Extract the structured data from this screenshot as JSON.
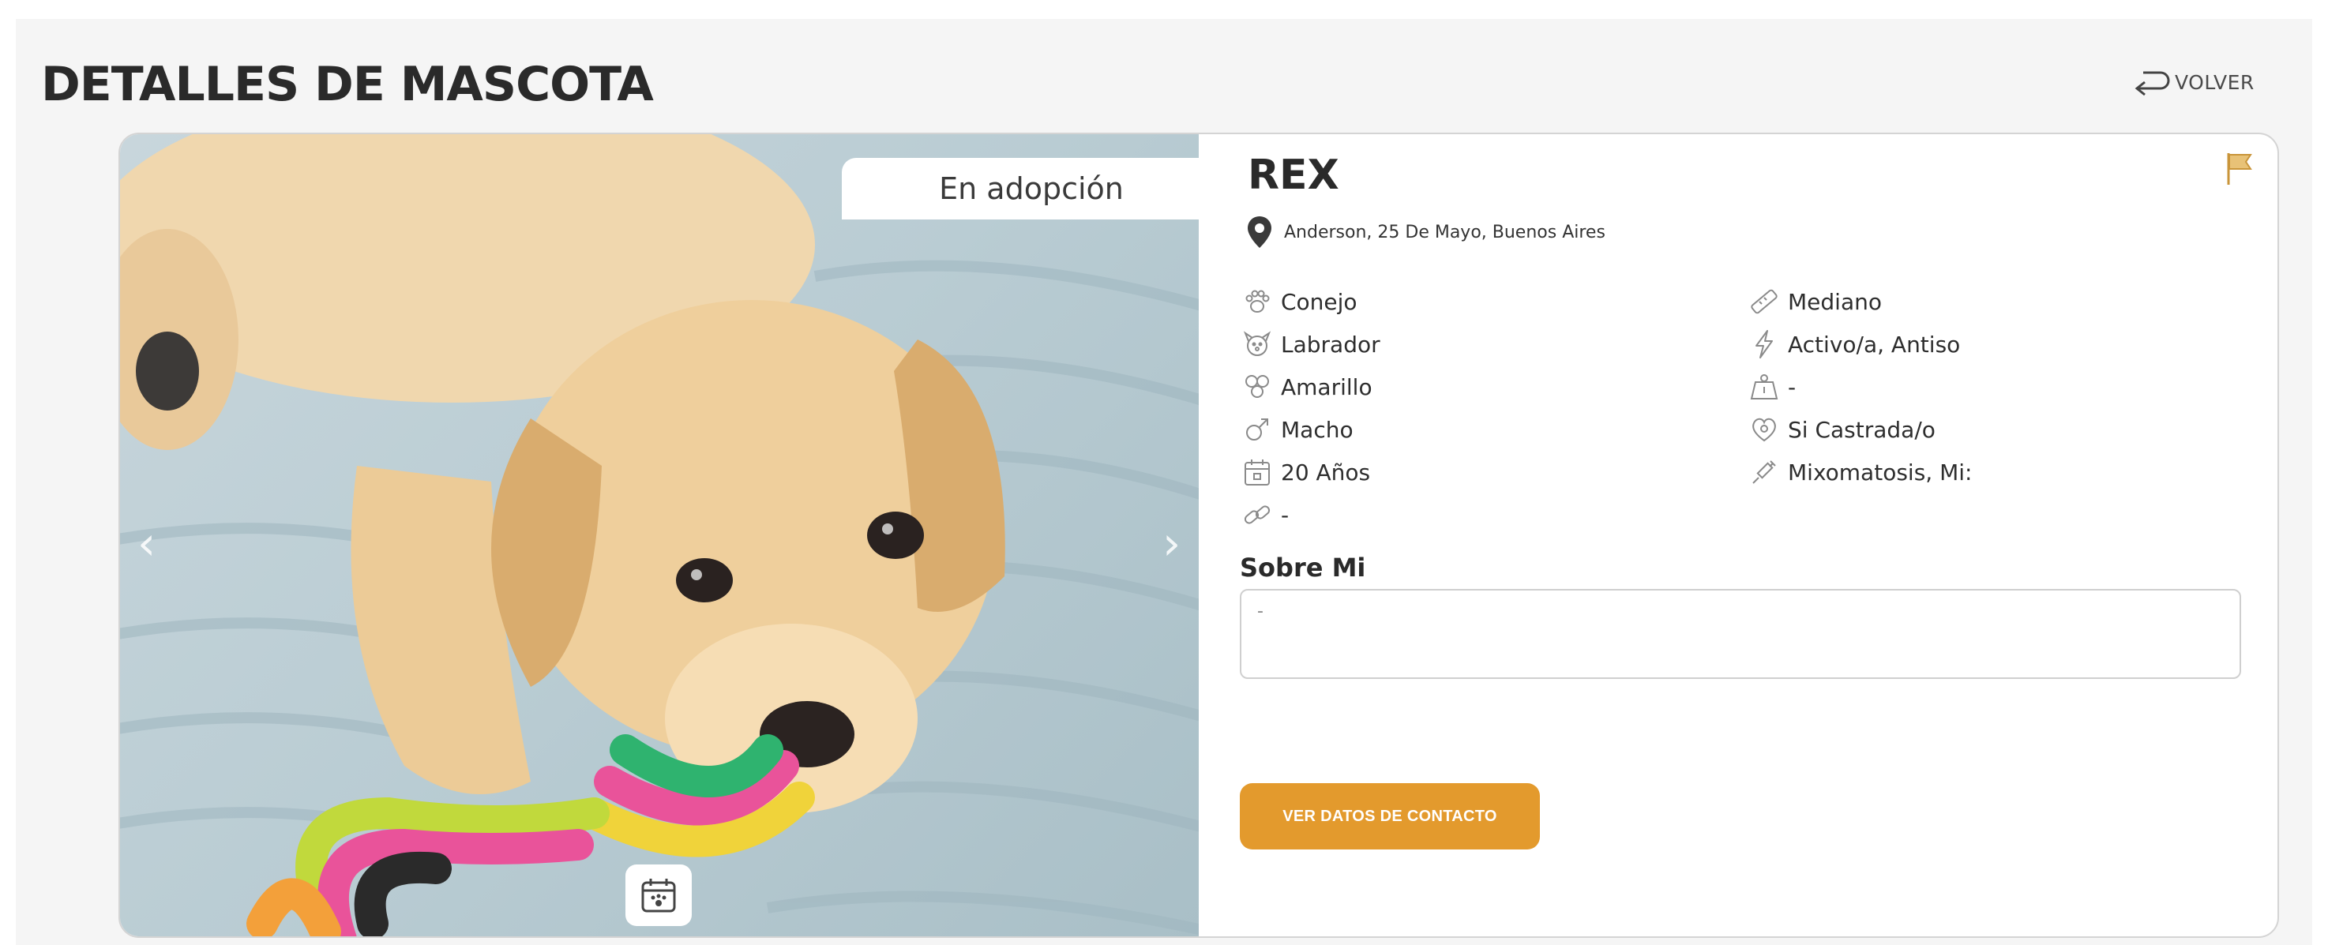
{
  "header": {
    "title": "DETALLES DE MASCOTA",
    "back_label": "VOLVER"
  },
  "photo": {
    "status_tab": "En adopción"
  },
  "pet": {
    "name": "REX",
    "location": "Anderson, 25 De Mayo, Buenos Aires",
    "attributes_left": [
      {
        "icon": "paw-icon",
        "value": "Conejo"
      },
      {
        "icon": "dog-face-icon",
        "value": "Labrador"
      },
      {
        "icon": "color-icon",
        "value": "Amarillo"
      },
      {
        "icon": "male-gender-icon",
        "value": "Macho"
      },
      {
        "icon": "calendar-icon",
        "value": "20 Años"
      },
      {
        "icon": "link-icon",
        "value": "-"
      }
    ],
    "attributes_right": [
      {
        "icon": "ruler-icon",
        "value": "Mediano"
      },
      {
        "icon": "energy-icon",
        "value": "Activo/a, Antiso"
      },
      {
        "icon": "weight-icon",
        "value": "-"
      },
      {
        "icon": "heart-icon",
        "value": "Si Castrada/o"
      },
      {
        "icon": "syringe-icon",
        "value": "Mixomatosis, Mi:"
      }
    ],
    "about_title": "Sobre Mi",
    "about_text": "-",
    "contact_button": "VER DATOS DE CONTACTO"
  },
  "colors": {
    "accent": "#e39a2d",
    "flag": "#d9a441",
    "text": "#2a2a2a"
  }
}
